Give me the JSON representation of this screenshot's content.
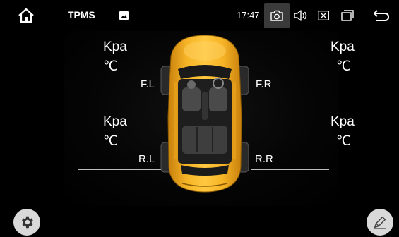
{
  "status_bar": {
    "app_title": "TPMS",
    "time": "17:47",
    "icons": [
      "home-icon",
      "image-icon",
      "camera-icon",
      "volume-icon",
      "close-box-icon",
      "recent-apps-icon",
      "back-icon"
    ]
  },
  "tires": {
    "front_left": {
      "label": "F.L",
      "pressure_unit": "Kpa",
      "temp_unit": "℃"
    },
    "front_right": {
      "label": "F.R",
      "pressure_unit": "Kpa",
      "temp_unit": "℃"
    },
    "rear_left": {
      "label": "R.L",
      "pressure_unit": "Kpa",
      "temp_unit": "℃"
    },
    "rear_right": {
      "label": "R.R",
      "pressure_unit": "Kpa",
      "temp_unit": "℃"
    }
  },
  "buttons": {
    "settings_icon": "gear-icon",
    "edit_icon": "pencil-icon"
  },
  "colors": {
    "car_body": "#f2a81d",
    "button_bg": "#d9d9d9",
    "camera_highlight": "#3a3a3a"
  }
}
